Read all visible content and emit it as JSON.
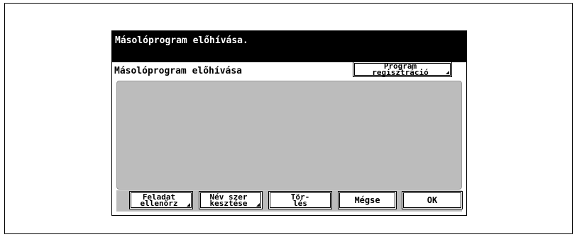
{
  "window": {
    "title": "Másolóprogram előhívása."
  },
  "panel": {
    "heading": "Másolóprogram előhívása",
    "program_button": "Program\nregisztráció",
    "list_items": []
  },
  "footer": {
    "task_check": "Feladat\nellenőrz",
    "rename": "Név szer\nkesztése",
    "delete": "Tör-\nlés",
    "cancel": "Mégse",
    "ok": "OK"
  }
}
